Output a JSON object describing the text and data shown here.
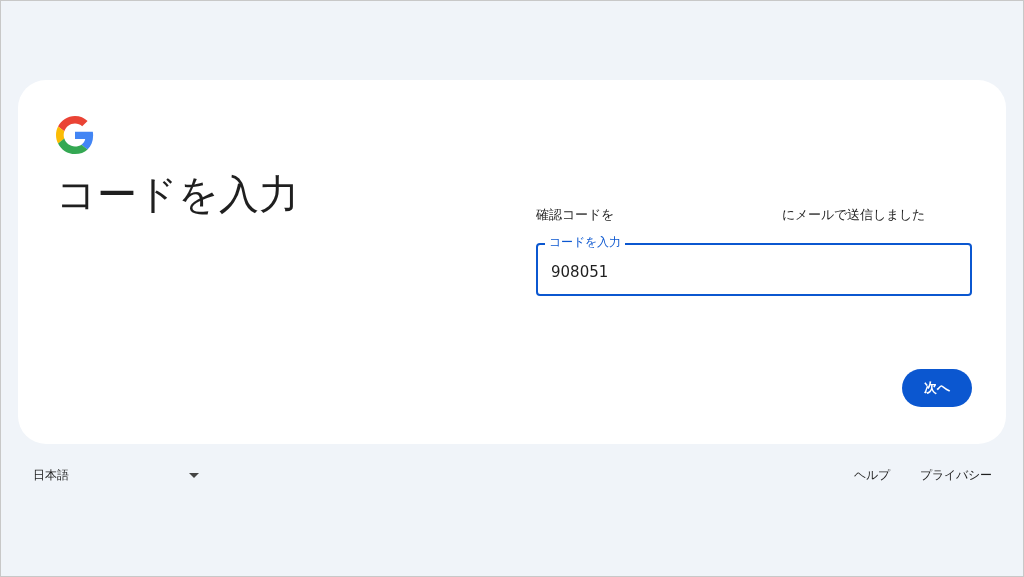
{
  "card": {
    "heading": "コードを入力",
    "message_before": "確認コードを",
    "message_after": "にメールで送信しました",
    "code_field": {
      "label": "コードを入力",
      "value": "908051",
      "focused": true
    },
    "next_button": "次へ"
  },
  "footer": {
    "language": "日本語",
    "links": [
      "ヘルプ",
      "プライバシー"
    ]
  }
}
